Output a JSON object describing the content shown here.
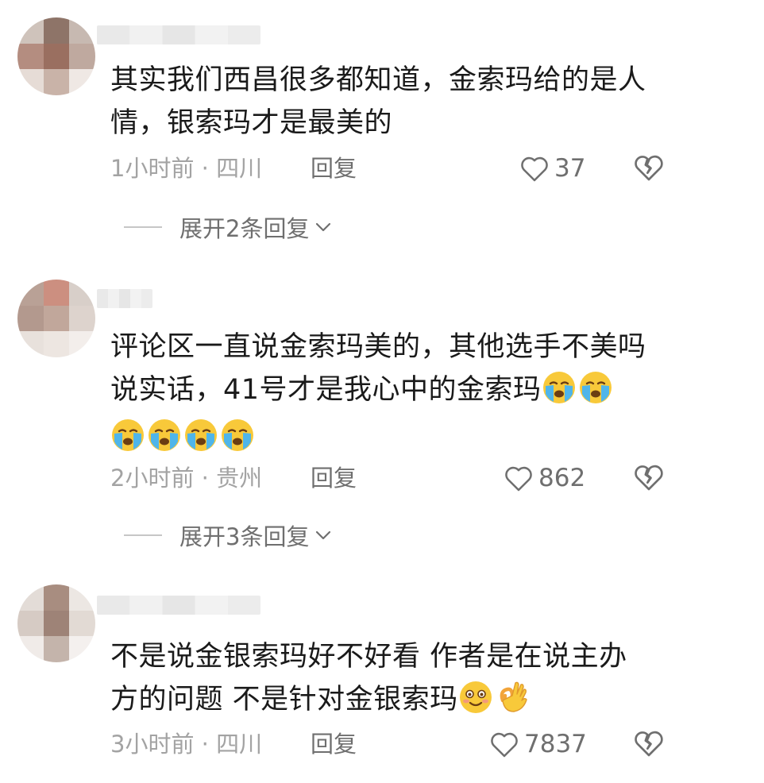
{
  "comments": [
    {
      "text_line1": "其实我们西昌很多都知道，金索玛给的是人",
      "text_line2": "情，银索玛才是最美的",
      "time": "1小时前 · 四川",
      "reply_label": "回复",
      "likes": "37",
      "expand_label": "展开2条回复"
    },
    {
      "text_line1": "评论区一直说金索玛美的，其他选手不美吗",
      "text_line2": "说实话，41号才是我心中的金索玛",
      "time": "2小时前 · 贵州",
      "reply_label": "回复",
      "likes": "862",
      "expand_label": "展开3条回复",
      "emojis_line2": [
        "loudly-crying-face",
        "loudly-crying-face"
      ],
      "emojis_line3": [
        "loudly-crying-face",
        "loudly-crying-face",
        "loudly-crying-face",
        "loudly-crying-face"
      ]
    },
    {
      "text_line1": "不是说金银索玛好不好看 作者是在说主办",
      "text_line2": "方的问题 不是针对金银索玛",
      "time": "3小时前 · 四川",
      "reply_label": "回复",
      "likes": "7837",
      "emojis_line2": [
        "flushed-smile-face",
        "ok-hand"
      ]
    }
  ],
  "colors": {
    "text": "#1a1a1a",
    "meta": "#a3a3a3",
    "action": "#6f6f6f",
    "emoji_yellow": "#f8c93a",
    "emoji_tears": "#4fb5ea"
  }
}
